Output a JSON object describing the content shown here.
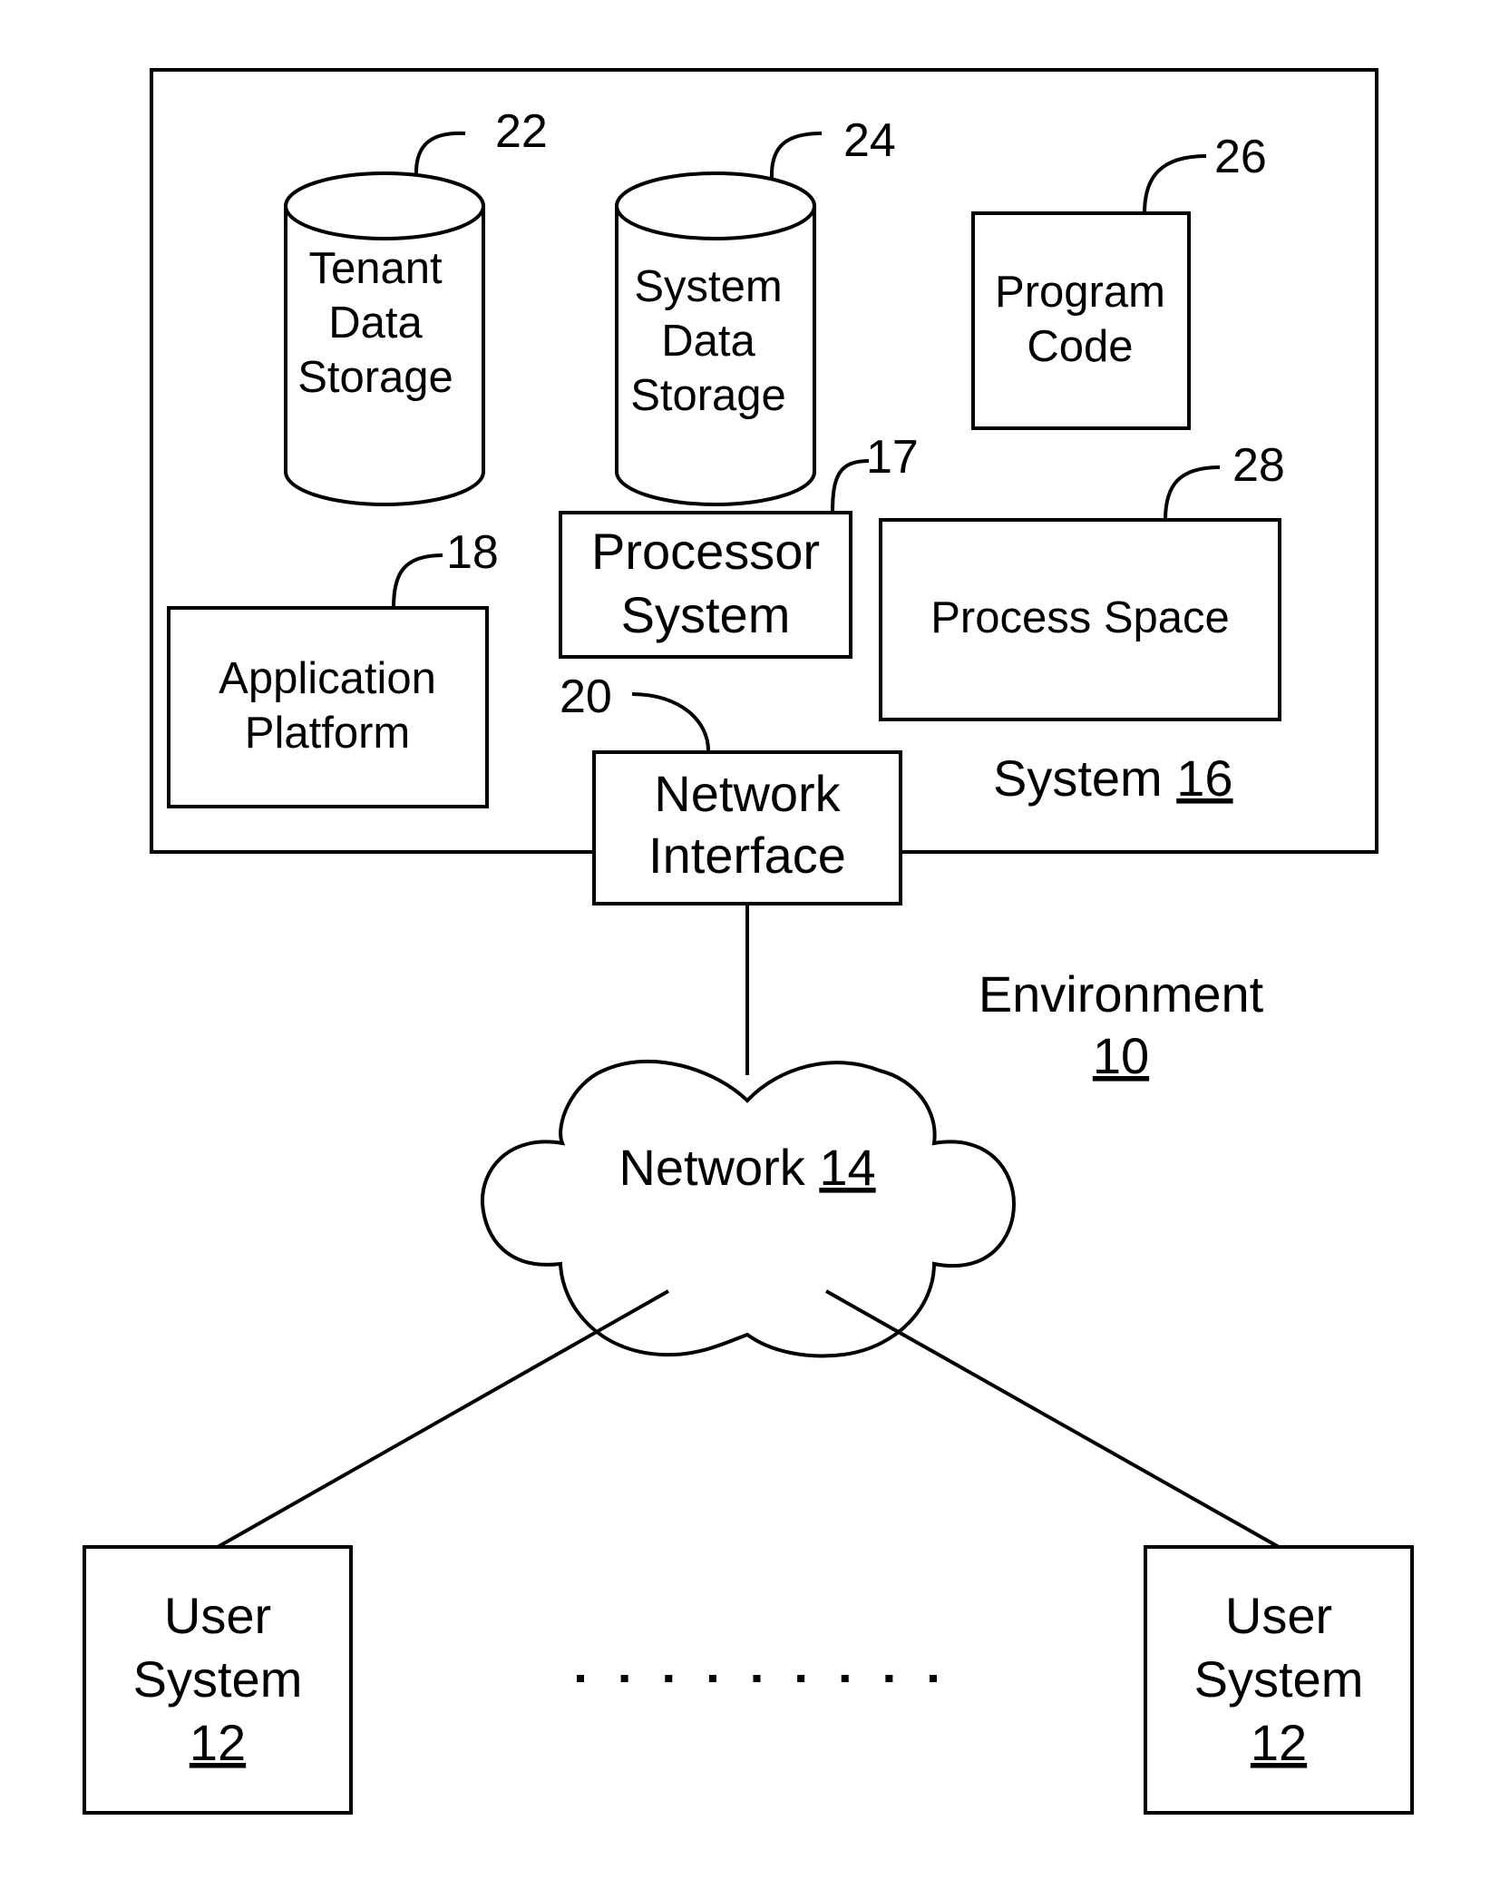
{
  "diagram": {
    "environment": {
      "label": "Environment",
      "ref": "10"
    },
    "system": {
      "label": "System",
      "ref": "16"
    },
    "tenant_storage": {
      "lines": [
        "Tenant",
        "Data",
        "Storage"
      ],
      "ref": "22"
    },
    "system_storage": {
      "lines": [
        "System",
        "Data",
        "Storage"
      ],
      "ref": "24"
    },
    "program_code": {
      "lines": [
        "Program",
        "Code"
      ],
      "ref": "26"
    },
    "processor_system": {
      "lines": [
        "Processor",
        "System"
      ],
      "ref": "17"
    },
    "process_space": {
      "label": "Process Space",
      "ref": "28"
    },
    "application_platform": {
      "lines": [
        "Application",
        "Platform"
      ],
      "ref": "18"
    },
    "network_interface": {
      "lines": [
        "Network",
        "Interface"
      ],
      "ref": "20"
    },
    "network": {
      "label": "Network",
      "ref": "14"
    },
    "user_system_left": {
      "lines": [
        "User",
        "System"
      ],
      "ref": "12"
    },
    "user_system_right": {
      "lines": [
        "User",
        "System"
      ],
      "ref": "12"
    },
    "ellipsis_dot_count": 9
  }
}
